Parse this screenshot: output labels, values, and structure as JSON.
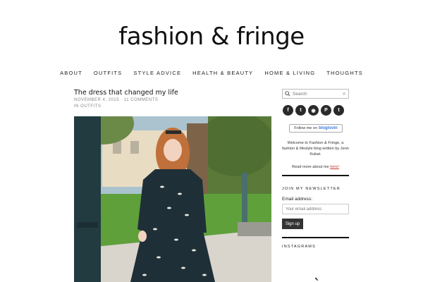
{
  "site": {
    "title": "fashion & fringe"
  },
  "nav": {
    "items": [
      {
        "label": "ABOUT"
      },
      {
        "label": "OUTFITS"
      },
      {
        "label": "STYLE ADVICE"
      },
      {
        "label": "HEALTH & BEAUTY"
      },
      {
        "label": "HOME & LIVING"
      },
      {
        "label": "THOUGHTS"
      }
    ]
  },
  "post": {
    "title": "The dress that changed my life",
    "meta": "NOVEMBER 4, 2015 · 11 COMMENTS",
    "category": "in OUTFITS"
  },
  "sidebar": {
    "search": {
      "placeholder": "Search",
      "clear": "×"
    },
    "socials": [
      {
        "icon": "facebook-icon",
        "glyph": "f"
      },
      {
        "icon": "twitter-icon",
        "glyph": "t"
      },
      {
        "icon": "rss-icon",
        "glyph": "◉"
      },
      {
        "icon": "pinterest-icon",
        "glyph": "P"
      },
      {
        "icon": "tumblr-icon",
        "glyph": "t"
      }
    ],
    "bloglovin": {
      "prefix": "Follow me on",
      "brand": "bloglovin"
    },
    "welcome": "Welcome to Fashion & Fringe, a fashion & lifestyle blog written by Jenn Kubat.",
    "readmore": {
      "text": "Read more about me",
      "link": "here!"
    },
    "newsletter": {
      "title": "JOIN MY NEWSLETTER",
      "label": "Email address:",
      "placeholder": "Your email address",
      "button": "Sign up"
    },
    "instagram": {
      "title": "INSTAGRAMS"
    }
  }
}
